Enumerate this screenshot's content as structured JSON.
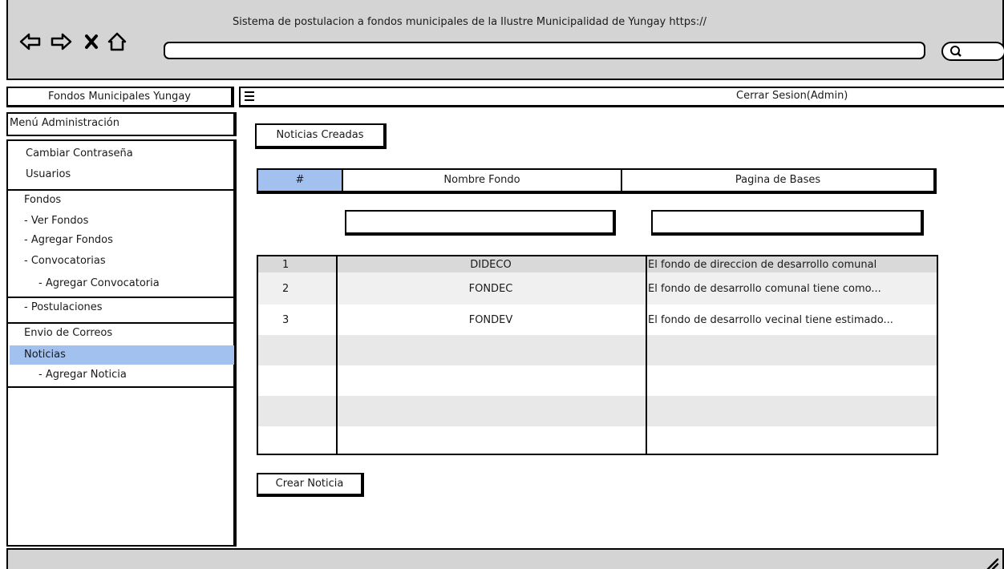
{
  "browser": {
    "title": "Sistema de postulacion a fondos municipales de la Ilustre Municipalidad de Yungay https://",
    "nav_icons": [
      "back-arrow-icon",
      "forward-arrow-icon",
      "stop-icon",
      "home-icon"
    ],
    "url_value": "",
    "search_icon": "search-icon"
  },
  "header": {
    "app_title": "Fondos Municipales Yungay",
    "menu_icon": "hamburger-menu-icon",
    "logout_label": "Cerrar Sesion(Admin)"
  },
  "sidebar": {
    "heading": "Menú Administración",
    "items": [
      {
        "label": "Cambiar Contraseña"
      },
      {
        "label": "Usuarios"
      },
      {
        "label": "Fondos"
      },
      {
        "label": "- Ver Fondos"
      },
      {
        "label": "- Agregar Fondos"
      },
      {
        "label": "- Convocatorias"
      },
      {
        "label": "- Agregar Convocatoria"
      },
      {
        "label": "- Postulaciones"
      },
      {
        "label": "Envio de Correos"
      },
      {
        "label": "Noticias"
      },
      {
        "label": "- Agregar Noticia"
      }
    ],
    "active_item": "Noticias"
  },
  "main": {
    "section_button": "Noticias Creadas",
    "table": {
      "headers": [
        "#",
        "Nombre Fondo",
        "Pagina de Bases"
      ],
      "filters": {
        "nombre_fondo": "",
        "pagina_bases": ""
      },
      "rows": [
        [
          "1",
          "DIDECO",
          "El fondo de direccion de desarrollo comunal"
        ],
        [
          "2",
          "FONDEC",
          "El fondo de desarrollo comunal tiene como..."
        ],
        [
          "3",
          "FONDEV",
          "El fondo de desarrollo vecinal tiene estimado..."
        ]
      ]
    },
    "create_button": "Crear Noticia"
  },
  "colors": {
    "chrome_gray": "#d4d4d4",
    "selected_blue": "#a3c1ee",
    "row_stripe": "#e8e8e8",
    "first_row_gray": "#d9d9d9"
  }
}
